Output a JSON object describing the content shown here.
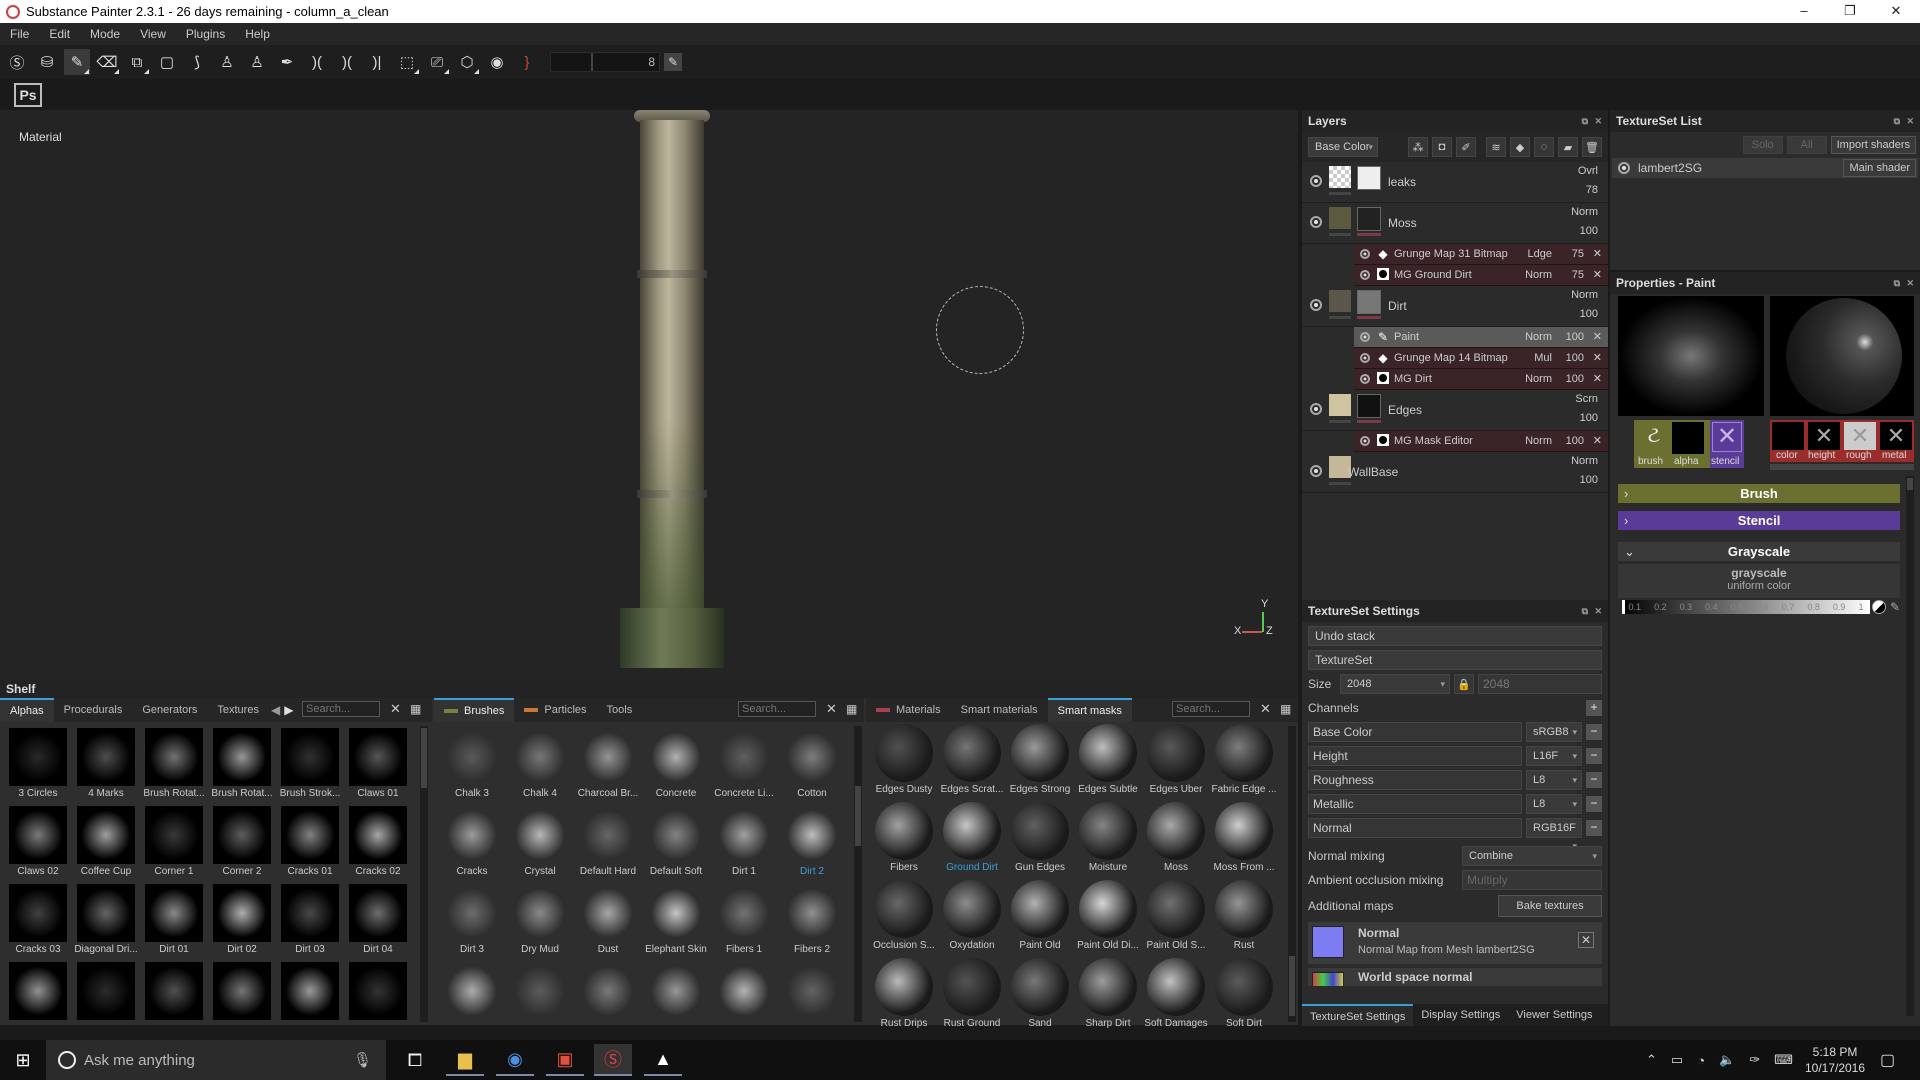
{
  "window": {
    "title": "Substance Painter 2.3.1 - 26 days remaining - column_a_clean",
    "controls": [
      "–",
      "❐",
      "✕"
    ]
  },
  "menu": [
    "File",
    "Edit",
    "Mode",
    "View",
    "Plugins",
    "Help"
  ],
  "toolbar": {
    "tools": [
      {
        "name": "substance-share-icon",
        "glyph": "Ⓢ"
      },
      {
        "name": "substance-source-icon",
        "glyph": "⛁"
      },
      {
        "name": "paint-brush-tool",
        "glyph": "✎",
        "active": true
      },
      {
        "name": "eraser-tool",
        "glyph": "⌫"
      },
      {
        "name": "projection-tool",
        "glyph": "⧉"
      },
      {
        "name": "polygon-fill-tool",
        "glyph": "▢"
      },
      {
        "name": "smudge-tool",
        "glyph": "⟆"
      },
      {
        "name": "clone-tool",
        "glyph": "♙"
      },
      {
        "name": "material-picker-tool",
        "glyph": "♙"
      },
      {
        "name": "color-picker-tool",
        "glyph": "✒"
      },
      {
        "name": "symmetry-toggle",
        "glyph": ")("
      },
      {
        "name": "symmetry-x",
        "glyph": ")("
      },
      {
        "name": "symmetry-mirror",
        "glyph": ")|"
      },
      {
        "name": "view-3d-icon",
        "glyph": "⬚"
      },
      {
        "name": "camera-icon",
        "glyph": "⎚"
      },
      {
        "name": "cube-view-icon",
        "glyph": "⬡"
      },
      {
        "name": "screenshot-icon",
        "glyph": "◉"
      },
      {
        "name": "lazy-mouse-icon",
        "glyph": "}"
      }
    ],
    "size_value": "8",
    "ps_label": "Ps"
  },
  "viewport": {
    "label": "Material",
    "axes": {
      "x": "X",
      "y": "Y",
      "z": "Z"
    }
  },
  "layers": {
    "title": "Layers",
    "channel_select": "Base Color",
    "rows": [
      {
        "type": "layer",
        "name": "leaks",
        "blend": "Ovrl",
        "opacity": "78"
      },
      {
        "type": "layer",
        "name": "Moss",
        "blend": "Norm",
        "opacity": "100"
      },
      {
        "type": "effect",
        "icon": "fill",
        "name": "Grunge Map 31 Bitmap",
        "blend": "Ldge",
        "opacity": "75"
      },
      {
        "type": "effect",
        "icon": "generator",
        "name": "MG Ground Dirt",
        "blend": "Norm",
        "opacity": "75"
      },
      {
        "type": "layer",
        "name": "Dirt",
        "blend": "Norm",
        "opacity": "100"
      },
      {
        "type": "effect",
        "icon": "paint",
        "name": "Paint",
        "blend": "Norm",
        "opacity": "100",
        "selected": true
      },
      {
        "type": "effect",
        "icon": "fill",
        "name": "Grunge Map 14 Bitmap",
        "blend": "Mul",
        "opacity": "100"
      },
      {
        "type": "effect",
        "icon": "generator",
        "name": "MG Dirt",
        "blend": "Norm",
        "opacity": "100"
      },
      {
        "type": "layer",
        "name": "Edges",
        "blend": "Scrn",
        "opacity": "100"
      },
      {
        "type": "effect",
        "icon": "generator",
        "name": "MG Mask Editor",
        "blend": "Norm",
        "opacity": "100"
      },
      {
        "type": "layer",
        "name": "WallBase",
        "blend": "Norm",
        "opacity": "100"
      }
    ]
  },
  "textureset_list": {
    "title": "TextureSet List",
    "solo": "Solo",
    "all": "All",
    "import_shaders": "Import shaders",
    "item": "lambert2SG",
    "shader": "Main shader"
  },
  "properties": {
    "title": "Properties - Paint",
    "slots_left": [
      "brush",
      "alpha",
      "stencil"
    ],
    "slots_right": [
      "color",
      "height",
      "rough",
      "metal"
    ],
    "sections": {
      "brush": "Brush",
      "stencil": "Stencil",
      "grayscale": "Grayscale"
    },
    "grayscale_label": "grayscale",
    "grayscale_mode": "uniform color",
    "scale_ticks": [
      "0.1",
      "0.2",
      "0.3",
      "0.4",
      "0.5",
      "0.6",
      "0.7",
      "0.8",
      "0.9",
      "1"
    ],
    "grayscale_value": 0,
    "colors": {
      "brush": "#6b7030",
      "stencil": "#5a3c98",
      "material": "#9a2c2c"
    }
  },
  "textureset_settings": {
    "title": "TextureSet Settings",
    "undo_stack": "Undo stack",
    "textureset": "TextureSet",
    "size_label": "Size",
    "size_value": "2048",
    "size_value2": "2048",
    "channels_label": "Channels",
    "channels": [
      {
        "name": "Base Color",
        "format": "sRGB8"
      },
      {
        "name": "Height",
        "format": "L16F"
      },
      {
        "name": "Roughness",
        "format": "L8"
      },
      {
        "name": "Metallic",
        "format": "L8"
      },
      {
        "name": "Normal",
        "format": "RGB16F"
      }
    ],
    "normal_mixing_label": "Normal mixing",
    "normal_mixing_value": "Combine",
    "ao_mixing_label": "Ambient occlusion mixing",
    "ao_mixing_value": "Multiply",
    "additional_maps_label": "Additional maps",
    "bake_button": "Bake textures",
    "maps": [
      {
        "title": "Normal",
        "subtitle": "Normal Map from Mesh lambert2SG"
      },
      {
        "title": "World space normal",
        "subtitle": ""
      }
    ],
    "tabs": [
      "TextureSet Settings",
      "Display Settings",
      "Viewer Settings"
    ]
  },
  "shelf": {
    "title": "Shelf",
    "alphas_panel": {
      "tabs": [
        "Alphas",
        "Procedurals",
        "Generators",
        "Textures"
      ],
      "search_placeholder": "Search...",
      "items": [
        "3 Circles",
        "4 Marks",
        "Brush Rotat...",
        "Brush Rotat...",
        "Brush Strok...",
        "Claws 01",
        "Claws 02",
        "Coffee Cup",
        "Corner 1",
        "Corner 2",
        "Cracks 01",
        "Cracks 02",
        "Cracks 03",
        "Diagonal Dri...",
        "Dirt 01",
        "Dirt 02",
        "Dirt 03",
        "Dirt 04",
        "",
        "",
        "",
        "",
        "",
        ""
      ]
    },
    "brushes_panel": {
      "tabs": [
        "Brushes",
        "Particles",
        "Tools"
      ],
      "search_placeholder": "Search...",
      "items": [
        "Chalk 3",
        "Chalk 4",
        "Charcoal Br...",
        "Concrete",
        "Concrete Li...",
        "Cotton",
        "Cracks",
        "Crystal",
        "Default Hard",
        "Default Soft",
        "Dirt 1",
        "Dirt 2",
        "Dirt 3",
        "Dry Mud",
        "Dust",
        "Elephant Skin",
        "Fibers 1",
        "Fibers 2",
        "",
        "",
        "",
        "",
        "",
        ""
      ],
      "highlighted": "Dirt 2"
    },
    "materials_panel": {
      "tabs": [
        "Materials",
        "Smart materials",
        "Smart masks"
      ],
      "search_placeholder": "Search...",
      "items": [
        "Edges Dusty",
        "Edges Scrat...",
        "Edges Strong",
        "Edges Subtle",
        "Edges Uber",
        "Fabric Edge ...",
        "Fibers",
        "Ground Dirt",
        "Gun Edges",
        "Moisture",
        "Moss",
        "Moss From ...",
        "Occlusion S...",
        "Oxydation",
        "Paint Old",
        "Paint Old Di...",
        "Paint Old S...",
        "Rust",
        "Rust Drips",
        "Rust Ground",
        "Sand",
        "Sharp Dirt",
        "Soft Damages",
        "Soft Dirt"
      ],
      "highlighted": "Ground Dirt"
    }
  },
  "taskbar": {
    "search_placeholder": "Ask me anything",
    "time": "5:18 PM",
    "date": "10/17/2016"
  }
}
